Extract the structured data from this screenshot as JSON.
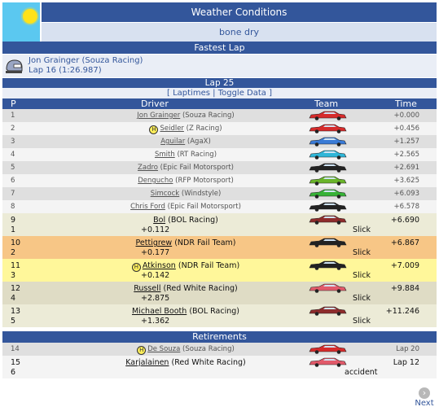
{
  "weather": {
    "title": "Weather Conditions",
    "value": "bone dry",
    "icon": "sun-icon"
  },
  "fastest_lap": {
    "title": "Fastest Lap",
    "driver": "Jon Grainger (Souza Racing)",
    "lap": "Lap 16 (1:26.987)",
    "icon": "helmet-icon"
  },
  "lap_header": {
    "title": "Lap 25",
    "open": "[",
    "laptimes": "Laptimes",
    "sep": "|",
    "toggle": "Toggle Data",
    "close": "]"
  },
  "columns": {
    "p": "P",
    "driver": "Driver",
    "team": "Team",
    "time": "Time"
  },
  "rows": [
    {
      "pos": "1",
      "name": "Jon Grainger",
      "team": "(Souza Racing)",
      "gap": "+0.000",
      "bg": "#dfdfdf",
      "livery": "#d62b2b"
    },
    {
      "pos": "2",
      "name": "Seidler",
      "team": "(Z Racing)",
      "gap": "+0.456",
      "bg": "#f4f4f4",
      "livery": "#d62b2b",
      "helmet": "H"
    },
    {
      "pos": "3",
      "name": "Aguilar",
      "team": "(AgaX)",
      "gap": "+1.257",
      "bg": "#dfdfdf",
      "livery": "#3a7bd6"
    },
    {
      "pos": "4",
      "name": "Smith",
      "team": "(RT Racing)",
      "gap": "+2.565",
      "bg": "#f4f4f4",
      "livery": "#2fb6d8"
    },
    {
      "pos": "5",
      "name": "Zadro",
      "team": "(Epic Fail Motorsport)",
      "gap": "+2.691",
      "bg": "#dfdfdf",
      "livery": "#222222"
    },
    {
      "pos": "6",
      "name": "Dengucho",
      "team": "(RFP Motorsport)",
      "gap": "+3.625",
      "bg": "#f4f4f4",
      "livery": "#6ab42a"
    },
    {
      "pos": "7",
      "name": "Simcock",
      "team": "(Windstyle)",
      "gap": "+6.093",
      "bg": "#dfdfdf",
      "livery": "#36b236"
    },
    {
      "pos": "8",
      "name": "Chris Ford",
      "team": "(Epic Fail Motorsport)",
      "gap": "+6.578",
      "bg": "#f4f4f4",
      "livery": "#222222"
    }
  ],
  "tall_rows": [
    {
      "pos": "9",
      "lap": "1",
      "name": "Bol",
      "team": "(BOL Racing)",
      "gap": "+6.690",
      "diff": "+0.112",
      "tyre": "Slick",
      "bg": "#ecebd7",
      "livery": "#8e2c2c"
    },
    {
      "pos": "10",
      "lap": "2",
      "name": "Pettigrew",
      "team": "(NDR Fail Team)",
      "gap": "+6.867",
      "diff": "+0.177",
      "tyre": "Slick",
      "bg": "#f7c686",
      "livery": "#222222"
    },
    {
      "pos": "11",
      "lap": "3",
      "name": "Atkinson",
      "team": "(NDR Fail Team)",
      "gap": "+7.009",
      "diff": "+0.142",
      "tyre": "Slick",
      "bg": "#fff79a",
      "livery": "#222222",
      "helmet": "H"
    },
    {
      "pos": "12",
      "lap": "4",
      "name": "Russell",
      "team": "(Red White Racing)",
      "gap": "+9.884",
      "diff": "+2.875",
      "tyre": "Slick",
      "bg": "#dfdcc5",
      "livery": "#e25a6a"
    },
    {
      "pos": "13",
      "lap": "5",
      "name": "Michael Booth",
      "team": "(BOL Racing)",
      "gap": "+11.246",
      "diff": "+1.362",
      "tyre": "Slick",
      "bg": "#ecebd7",
      "livery": "#8e2c2c"
    }
  ],
  "retirements": {
    "title": "Retirements",
    "rows": [
      {
        "pos": "14",
        "name": "De Souza",
        "team": "(Souza Racing)",
        "gap": "Lap 20",
        "bg": "#dfdfdf",
        "livery": "#d62b2b",
        "helmet": "H"
      },
      {
        "pos": "15",
        "lap": "6",
        "name": "Karjalainen",
        "team": "(Red White Racing)",
        "gap": "Lap 12",
        "reason": "accident",
        "bg": "#f4f4f4",
        "livery": "#e25a6a"
      }
    ]
  },
  "next": {
    "label": "Next",
    "icon": "chevron-right-icon"
  }
}
